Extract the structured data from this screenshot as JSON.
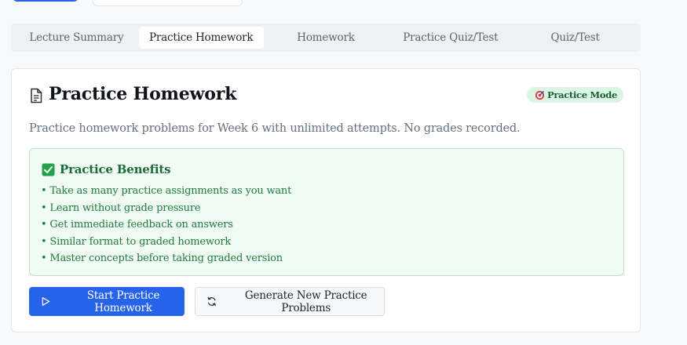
{
  "tabs": [
    {
      "label": "Lecture Summary",
      "active": false
    },
    {
      "label": "Practice Homework",
      "active": true
    },
    {
      "label": "Homework",
      "active": false
    },
    {
      "label": "Practice Quiz/Test",
      "active": false
    },
    {
      "label": "Quiz/Test",
      "active": false
    }
  ],
  "card": {
    "title": "Practice Homework",
    "title_icon": "document-icon",
    "badge": {
      "label": "Practice Mode",
      "icon": "target-icon",
      "color": "#d9f5e3"
    },
    "description": "Practice homework problems for Week 6 with unlimited attempts. No grades recorded.",
    "benefits": {
      "heading": "Practice Benefits",
      "heading_icon": "check-box-icon",
      "items": [
        "• Take as many practice assignments as you want",
        "• Learn without grade pressure",
        "• Get immediate feedback on answers",
        "• Similar format to graded homework",
        "• Master concepts before taking graded version"
      ]
    },
    "actions": {
      "start_label": "Start Practice Homework",
      "start_icon": "play-icon",
      "generate_label": "Generate New Practice Problems",
      "generate_icon": "refresh-icon"
    }
  },
  "colors": {
    "accent": "#2563eb",
    "success_bg": "#effbf3",
    "success_text": "#227a41"
  }
}
